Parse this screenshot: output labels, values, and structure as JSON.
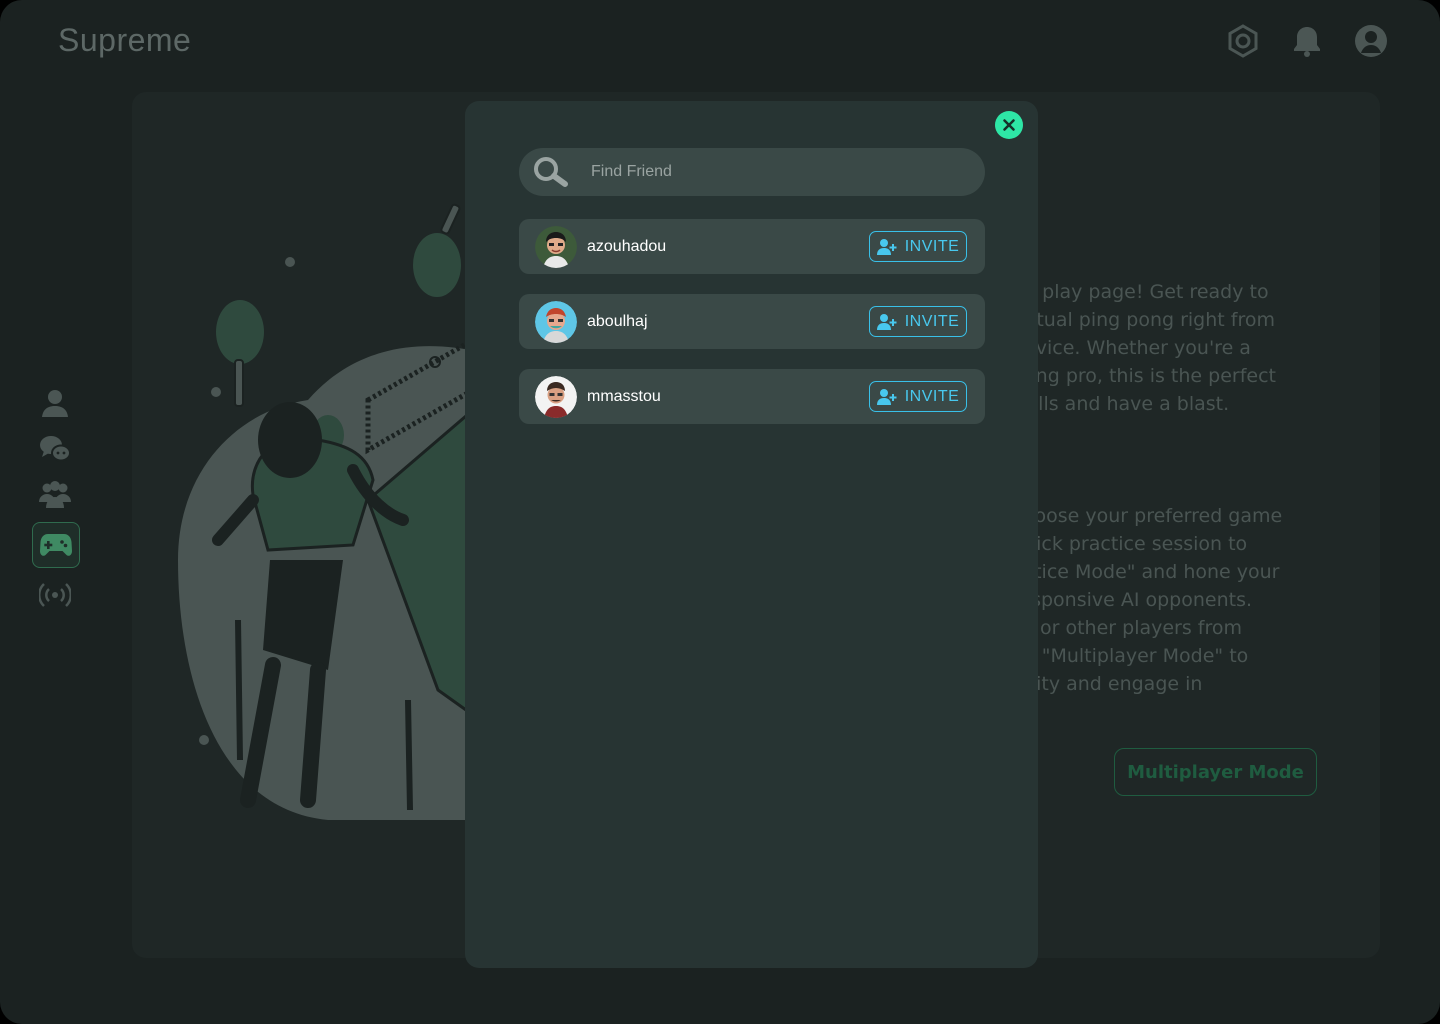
{
  "app": {
    "brand": "Supreme"
  },
  "header": {
    "icons": [
      "settings-icon",
      "bell-icon",
      "user-avatar-icon"
    ]
  },
  "sidebar": {
    "items": [
      {
        "id": "profile",
        "icon": "user-icon",
        "active": false
      },
      {
        "id": "chat",
        "icon": "chat-icon",
        "active": false
      },
      {
        "id": "friends",
        "icon": "users-icon",
        "active": false
      },
      {
        "id": "game",
        "icon": "gamepad-icon",
        "active": true
      },
      {
        "id": "live",
        "icon": "broadcast-icon",
        "active": false
      }
    ]
  },
  "background": {
    "paragraph1": "ng play page! Get ready to\nvirtual ping pong right from\n device. Whether you're a\npong pro, this is the perfect\n skills and have a blast.",
    "paragraph2": "choose your preferred game\nquick practice session to\nactice Mode\" and hone your\n responsive AI opponents.\nds or other players from\n on \"Multiplayer Mode\" to\nunity and engage in",
    "multiplayer_button": "Multiplayer Mode"
  },
  "modal": {
    "search": {
      "placeholder": "Find Friend",
      "value": ""
    },
    "friends": [
      {
        "username": "azouhadou",
        "invite_label": "INVITE"
      },
      {
        "username": "aboulhaj",
        "invite_label": "INVITE"
      },
      {
        "username": "mmasstou",
        "invite_label": "INVITE"
      }
    ]
  },
  "colors": {
    "accent": "#2ee6a6",
    "invite": "#48c8ee",
    "panel": "#273433",
    "row": "#3a4947"
  }
}
